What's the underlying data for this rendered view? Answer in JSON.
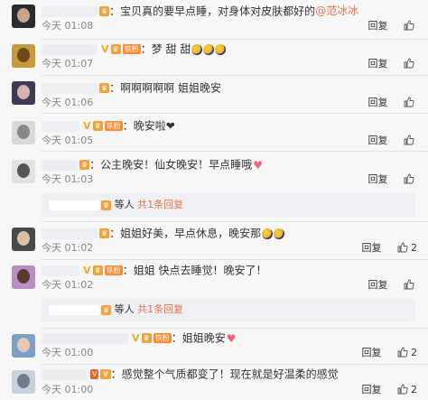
{
  "reply_label": "回复",
  "comments": [
    {
      "text": "：宝贝真的要早点睡，对身体对皮肤都好的",
      "mention": "@范冰冰",
      "time": "今天 01:08",
      "likes": ""
    },
    {
      "text": "：梦 甜 甜",
      "time": "今天 01:07",
      "likes": "",
      "badge": "铁粉"
    },
    {
      "text": "：啊啊啊啊啊 姐姐晚安",
      "time": "今天 01:06",
      "likes": ""
    },
    {
      "text": "：晚安啦❤",
      "time": "今天 01:05",
      "likes": "",
      "badge": "铁粉"
    },
    {
      "text": "：公主晚安！仙女晚安！早点睡哦",
      "time": "今天 01:03",
      "likes": "",
      "sub": {
        "suffix": " 等人 ",
        "link": "共1条回复"
      }
    },
    {
      "text": "：姐姐好美，早点休息，晚安那",
      "time": "今天 01:02",
      "likes": "2"
    },
    {
      "text": "：姐姐 快点去睡觉！晚安了！",
      "time": "今天 01:02",
      "likes": "",
      "badge": "铁粉",
      "sub": {
        "suffix": " 等人 ",
        "link": "共1条回复"
      }
    },
    {
      "text": "：姐姐晚安",
      "time": "今天 01:00",
      "likes": "2",
      "badge": "铁粉"
    },
    {
      "text": "：感觉整个气质都变了！现在就是好温柔的感觉",
      "time": "今天 01:00",
      "likes": "2",
      "badge": "V"
    }
  ],
  "colors": {
    "link": "#eb7350",
    "badge": "#f2a23b",
    "heart": "#f0657b"
  }
}
